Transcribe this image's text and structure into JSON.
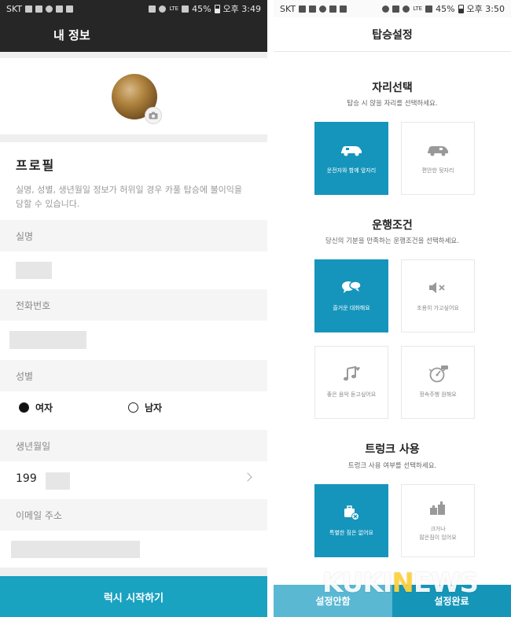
{
  "left_screen": {
    "statusbar": {
      "carrier": "SKT",
      "network": "LTE",
      "battery": "45%",
      "time": "오후 3:49"
    },
    "header": {
      "title": "내 정보"
    },
    "avatar": {
      "badge_icon": "camera-icon"
    },
    "profile": {
      "title": "프로필",
      "notice": "실명, 성별, 생년월일 정보가 허위일 경우 카풀 탑승에 불이익을 당할 수 있습니다."
    },
    "fields": {
      "name_label": "실명",
      "phone_label": "전화번호",
      "gender_label": "성별",
      "gender_female": "여자",
      "gender_male": "남자",
      "gender_selected": "여자",
      "dob_label": "생년월일",
      "dob_value": "199",
      "email_label": "이메일 주소"
    },
    "start_button": "럭시 시작하기"
  },
  "right_screen": {
    "statusbar": {
      "carrier": "SKT",
      "network": "LTE",
      "battery": "45%",
      "time": "오후 3:50"
    },
    "header": {
      "title": "탑승설정"
    },
    "seat": {
      "title": "자리선택",
      "description": "탑승 시 앉을 자리를 선택하세요.",
      "options": [
        {
          "label": "운전자와 함께 앞자리",
          "icon": "car-icon",
          "selected": true
        },
        {
          "label": "편안한 뒷자리",
          "icon": "car-icon",
          "selected": false
        }
      ]
    },
    "driving": {
      "title": "운행조건",
      "description": "당신의 기분을 만족하는 운행조건을 선택하세요.",
      "options": [
        {
          "label": "즐거운 대화해요",
          "icon": "chat-bubbles-icon",
          "selected": true
        },
        {
          "label": "조용히 가고싶어요",
          "icon": "mute-icon",
          "selected": false
        },
        {
          "label": "좋은 음악 듣고싶어요",
          "icon": "music-note-icon",
          "selected": false
        },
        {
          "label": "정속주행 원해요",
          "icon": "speedometer-icon",
          "selected": false
        }
      ]
    },
    "trunk": {
      "title": "트렁크 사용",
      "description": "트렁크 사용 여부를 선택하세요.",
      "options": [
        {
          "label": "특별한 짐은 없어요",
          "icon": "no-luggage-icon",
          "selected": true
        },
        {
          "label_line1": "크거나",
          "label_line2": "많은짐이 있어요",
          "icon": "luggage-icon",
          "selected": false
        }
      ]
    },
    "buttons": {
      "skip": "설정안함",
      "done": "설정완료"
    }
  },
  "watermark": {
    "part1": "KUKI",
    "part2": "N",
    "part3": "EWS"
  },
  "colors": {
    "accent": "#1aa2c1",
    "selected_card": "#1595bb",
    "header_dark": "#262626",
    "skip_button": "#5ab8d3"
  }
}
